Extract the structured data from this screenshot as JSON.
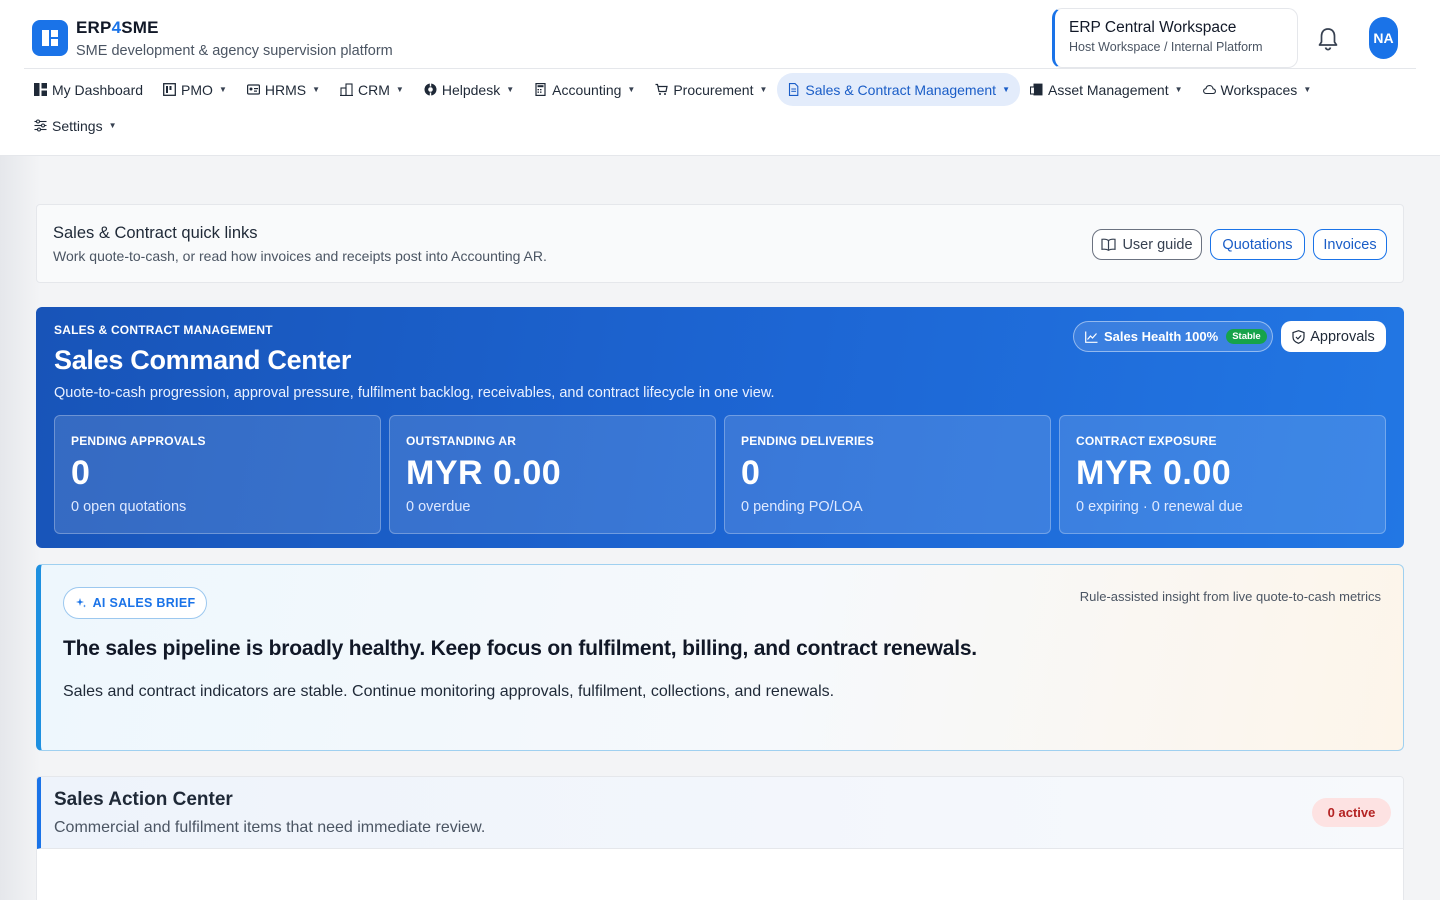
{
  "brand": {
    "name_prefix": "ERP",
    "name_accent": "4",
    "name_suffix": "SME",
    "subtitle": "SME development & agency supervision platform"
  },
  "workspace": {
    "title": "ERP Central Workspace",
    "subtitle": "Host Workspace / Internal Platform"
  },
  "user": {
    "initials": "NA"
  },
  "nav": {
    "items": [
      {
        "label": "My Dashboard",
        "icon": "dashboard-icon"
      },
      {
        "label": "PMO",
        "icon": "kanban-icon"
      },
      {
        "label": "HRMS",
        "icon": "id-card-icon"
      },
      {
        "label": "CRM",
        "icon": "building-icon"
      },
      {
        "label": "Helpdesk",
        "icon": "lifebuoy-icon"
      },
      {
        "label": "Accounting",
        "icon": "calculator-icon"
      },
      {
        "label": "Procurement",
        "icon": "cart-icon"
      },
      {
        "label": "Sales & Contract Management",
        "icon": "document-icon",
        "active": true
      },
      {
        "label": "Asset Management",
        "icon": "devices-icon"
      },
      {
        "label": "Workspaces",
        "icon": "cloud-icon"
      },
      {
        "label": "Settings",
        "icon": "sliders-icon"
      }
    ]
  },
  "quick_links": {
    "title": "Sales & Contract quick links",
    "subtitle": "Work quote-to-cash, or read how invoices and receipts post into Accounting AR.",
    "guide_label": "User guide",
    "quotations_label": "Quotations",
    "invoices_label": "Invoices"
  },
  "command_center": {
    "eyebrow": "SALES & CONTRACT MANAGEMENT",
    "title": "Sales Command Center",
    "subtitle": "Quote-to-cash progression, approval pressure, fulfilment backlog, receivables, and contract lifecycle in one view.",
    "health_label": "Sales Health 100%",
    "health_status": "Stable",
    "approvals_label": "Approvals",
    "kpis": [
      {
        "label": "PENDING APPROVALS",
        "value": "0",
        "sub": "0 open quotations"
      },
      {
        "label": "OUTSTANDING AR",
        "value": "MYR 0.00",
        "sub": "0 overdue"
      },
      {
        "label": "PENDING DELIVERIES",
        "value": "0",
        "sub": "0 pending PO/LOA"
      },
      {
        "label": "CONTRACT EXPOSURE",
        "value": "MYR 0.00",
        "sub": "0 expiring · 0 renewal due"
      }
    ]
  },
  "ai_brief": {
    "pill": "AI SALES BRIEF",
    "meta": "Rule-assisted insight from live quote-to-cash metrics",
    "headline": "The sales pipeline is broadly healthy. Keep focus on fulfilment, billing, and contract renewals.",
    "body": "Sales and contract indicators are stable. Continue monitoring approvals, fulfilment, collections, and renewals."
  },
  "action_center": {
    "title": "Sales Action Center",
    "subtitle": "Commercial and fulfilment items that need immediate review.",
    "badge": "0 active"
  },
  "colors": {
    "primary": "#1a73e8",
    "command_bg": "#1d66d4",
    "stable": "#16a34a",
    "badge_bg": "#fde2e2",
    "badge_text": "#b42323"
  }
}
